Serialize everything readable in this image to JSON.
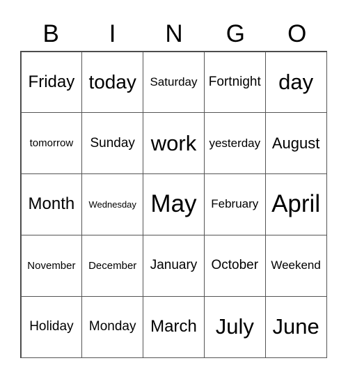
{
  "header": [
    "B",
    "I",
    "N",
    "G",
    "O"
  ],
  "cells": [
    [
      "Friday",
      "today",
      "Saturday",
      "Fortnight",
      "day"
    ],
    [
      "tomorrow",
      "Sunday",
      "work",
      "yesterday",
      "August"
    ],
    [
      "Month",
      "Wednesday",
      "May",
      "February",
      "April"
    ],
    [
      "November",
      "December",
      "January",
      "October",
      "Weekend"
    ],
    [
      "Holiday",
      "Monday",
      "March",
      "July",
      "June"
    ]
  ]
}
